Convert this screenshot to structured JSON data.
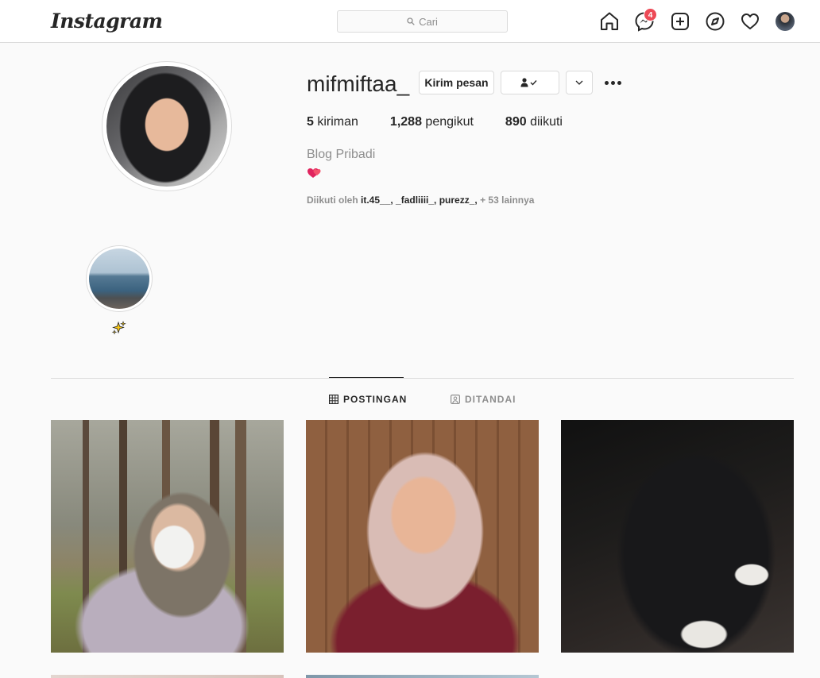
{
  "nav": {
    "logo": "Instagram",
    "search_placeholder": "Cari",
    "message_badge": "4",
    "icons": [
      "home-icon",
      "messenger-icon",
      "new-post-icon",
      "explore-icon",
      "activity-heart-icon",
      "profile-avatar"
    ]
  },
  "profile": {
    "username": "mifmiftaa_",
    "message_button": "Kirim pesan",
    "stats": [
      {
        "count": "5",
        "label": "kiriman"
      },
      {
        "count": "1,288",
        "label": "pengikut"
      },
      {
        "count": "890",
        "label": "diikuti"
      }
    ],
    "full_name": "Blog Pribadi",
    "bio_emoji": "two-hearts",
    "followed_by_prefix": "Diikuti oleh",
    "followed_by_names": "it.45__, _fadliiii_, purezz_,",
    "followed_by_more": "+ 53 lainnya"
  },
  "highlights": [
    {
      "label_icon": "sparkles-emoji"
    }
  ],
  "tabs": [
    {
      "label": "POSTINGAN",
      "active": true,
      "icon": "grid-icon"
    },
    {
      "label": "DITANDAI",
      "active": false,
      "icon": "tagged-icon"
    }
  ],
  "colors": {
    "badge": "#ed4956",
    "text": "#262626",
    "muted": "#8e8e8e",
    "border": "#dbdbdb"
  }
}
